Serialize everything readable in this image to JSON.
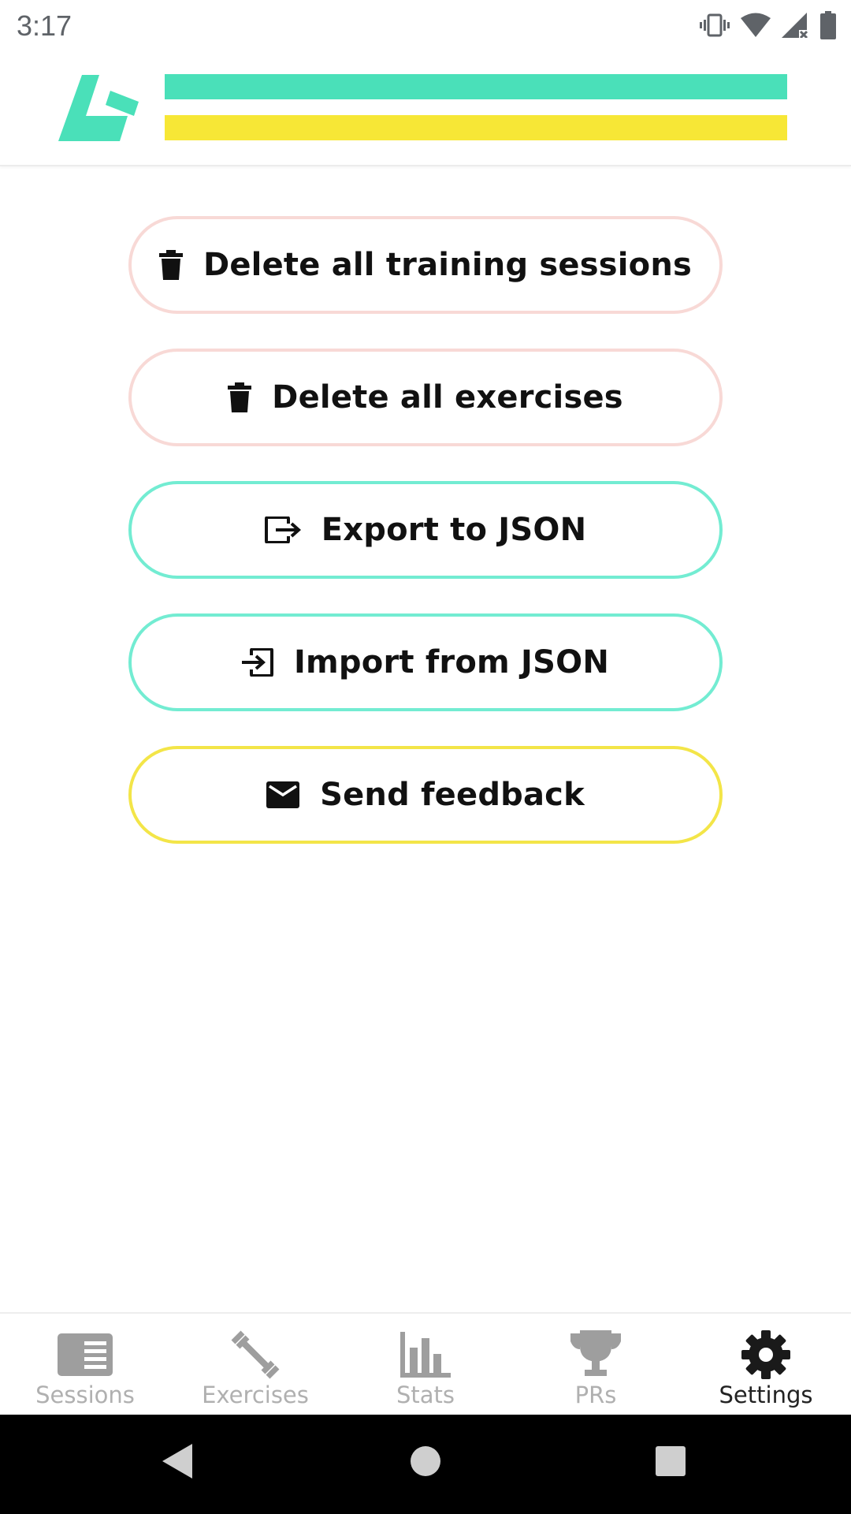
{
  "status_bar": {
    "time": "3:17",
    "icons": [
      "vibrate-icon",
      "wifi-icon",
      "signal-icon",
      "battery-icon"
    ]
  },
  "header": {
    "logo": "app-logo",
    "brand_colors": {
      "teal": "#4ae0b9",
      "yellow": "#f7e736"
    }
  },
  "actions": [
    {
      "label": "Delete all training sessions",
      "icon": "trash-icon",
      "tone": "danger"
    },
    {
      "label": "Delete all exercises",
      "icon": "trash-icon",
      "tone": "danger"
    },
    {
      "label": "Export to JSON",
      "icon": "export-icon",
      "tone": "teal"
    },
    {
      "label": "Import from JSON",
      "icon": "import-icon",
      "tone": "teal"
    },
    {
      "label": "Send feedback",
      "icon": "mail-icon",
      "tone": "yellow"
    }
  ],
  "bottom_nav": {
    "active": "Settings",
    "items": [
      {
        "label": "Sessions",
        "icon": "sessions-icon"
      },
      {
        "label": "Exercises",
        "icon": "dumbbell-icon"
      },
      {
        "label": "Stats",
        "icon": "bar-chart-icon"
      },
      {
        "label": "PRs",
        "icon": "trophy-icon"
      },
      {
        "label": "Settings",
        "icon": "gear-icon"
      }
    ]
  },
  "system_nav": [
    "back-icon",
    "home-icon",
    "recents-icon"
  ],
  "colors": {
    "danger_border": "#f8d9d6",
    "teal_border": "#73ecd2",
    "yellow_border": "#f3e548",
    "inactive_nav": "#b0b0b0",
    "active_nav": "#222222"
  }
}
